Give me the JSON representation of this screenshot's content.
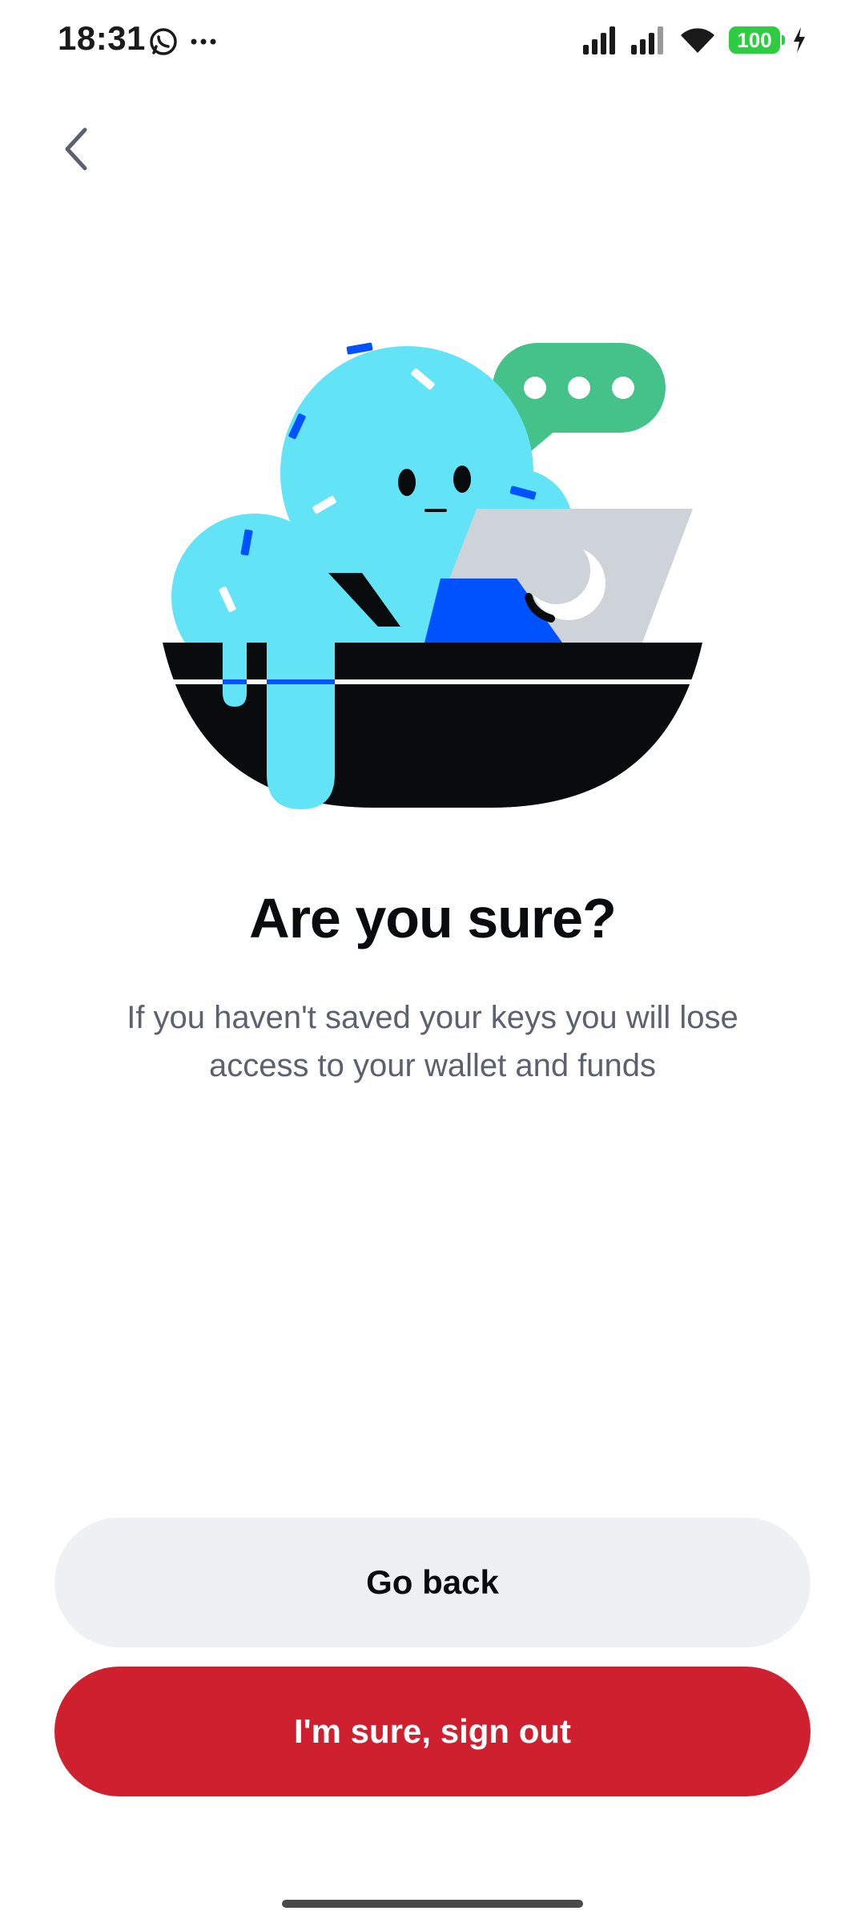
{
  "status_bar": {
    "time": "18:31",
    "battery": "100",
    "icons": [
      "whatsapp-icon",
      "more-dots-icon",
      "signal-icon",
      "signal-icon",
      "wifi-icon",
      "battery-icon",
      "charging-icon"
    ]
  },
  "header": {
    "back_icon": "chevron-left-icon"
  },
  "main": {
    "title": "Are you sure?",
    "subtitle": "If you haven't saved your keys you will lose access to your wallet and funds"
  },
  "actions": {
    "go_back_label": "Go back",
    "sign_out_label": "I'm sure, sign out"
  },
  "colors": {
    "danger": "#cf202f",
    "secondary_bg": "#eef0f3",
    "character": "#62e3f6",
    "accent_blue": "#0052ff",
    "bubble_green": "#44c28a"
  }
}
